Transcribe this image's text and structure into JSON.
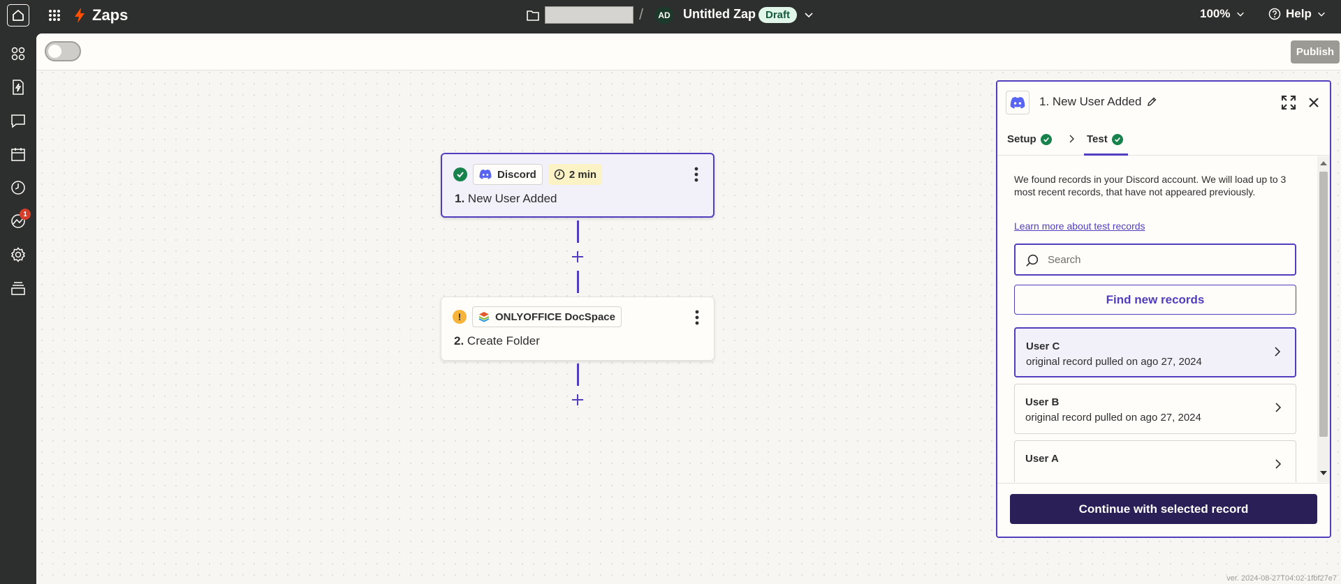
{
  "topbar": {
    "app_title": "Zaps",
    "avatar_initials": "AD",
    "zap_name": "Untitled Zap",
    "status_badge": "Draft",
    "zoom": "100%",
    "help_label": "Help"
  },
  "sidebar": {
    "notification_count": "1"
  },
  "toolbar": {
    "publish_label": "Publish"
  },
  "steps": [
    {
      "app": "Discord",
      "duration": "2 min",
      "number": "1.",
      "title": "New User Added"
    },
    {
      "app": "ONLYOFFICE DocSpace",
      "number": "2.",
      "title": "Create Folder"
    }
  ],
  "panel": {
    "title": "1. New User Added",
    "tabs": [
      {
        "label": "Setup"
      },
      {
        "label": "Test"
      }
    ],
    "intro_text": "We found records in your Discord account. We will load up to 3 most recent records, that have not appeared previously.",
    "learn_more": "Learn more about test records",
    "search_placeholder": "Search",
    "find_label": "Find new records",
    "records": [
      {
        "name": "User C",
        "sub": "original record pulled on ago 27, 2024"
      },
      {
        "name": "User B",
        "sub": "original record pulled on ago 27, 2024"
      },
      {
        "name": "User A",
        "sub": ""
      }
    ],
    "continue_label": "Continue with selected record"
  },
  "version": "ver. 2024-08-27T04:02-1fbf27e7",
  "colors": {
    "accent": "#503ebf",
    "brand_orange": "#ff4f00",
    "success": "#17824c",
    "warning": "#f6b43b",
    "discord": "#5865f2",
    "dark_button": "#2b1f57"
  }
}
